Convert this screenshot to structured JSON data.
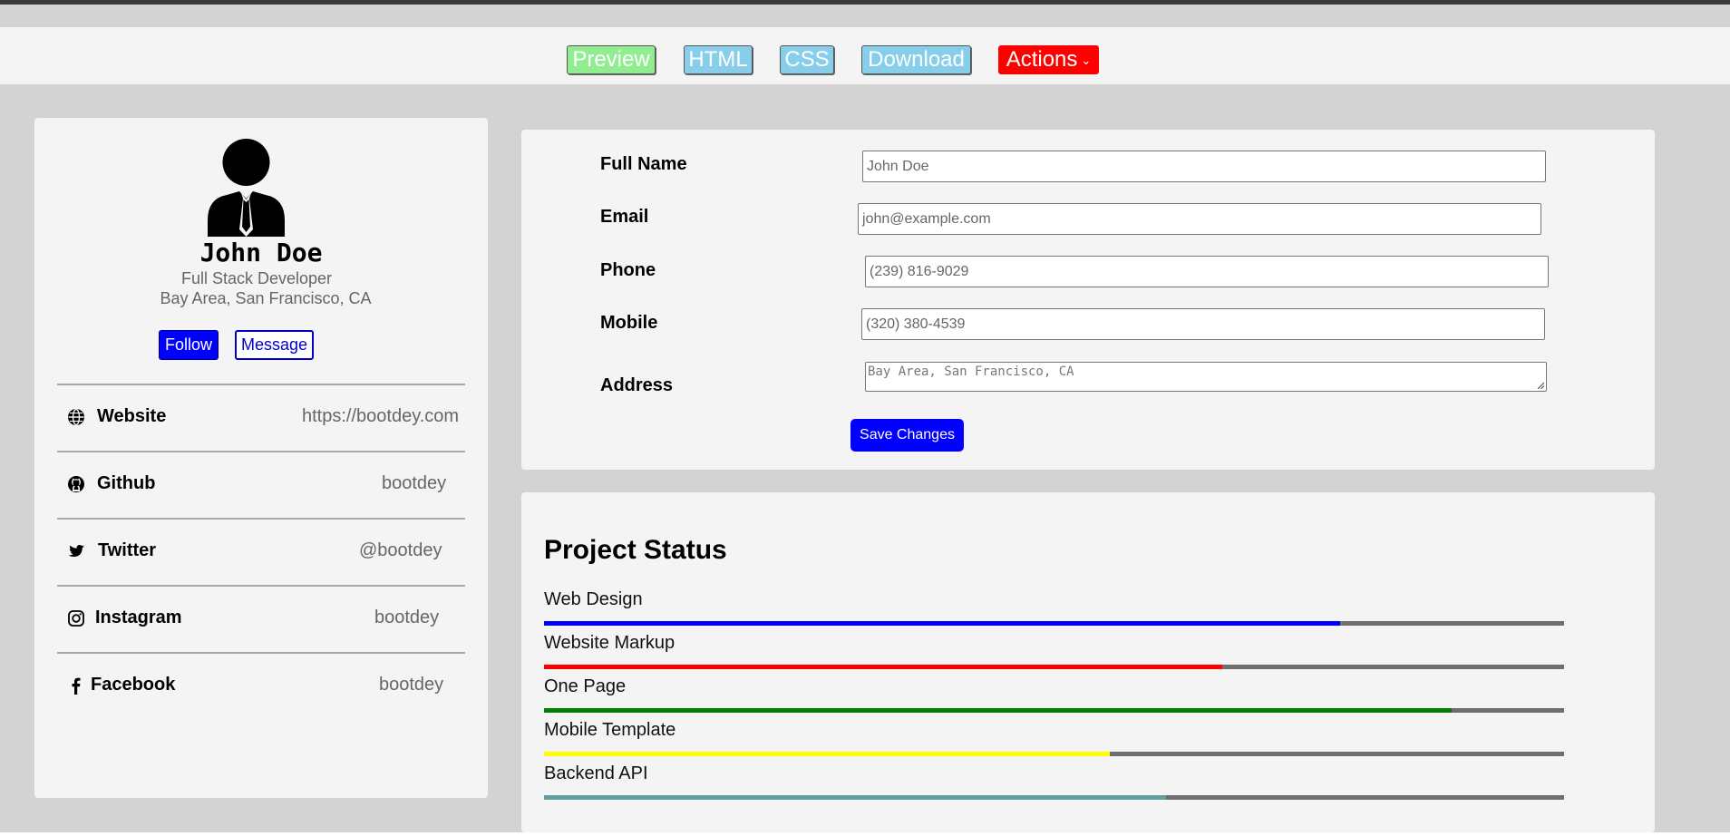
{
  "toolbar": {
    "preview": "Preview",
    "html": "HTML",
    "css": "CSS",
    "download": "Download",
    "actions": "Actions",
    "actions_chevron": "⌄"
  },
  "profile": {
    "name": "John Doe",
    "role": "Full Stack Developer",
    "location": "Bay Area, San Francisco, CA",
    "follow_label": "Follow",
    "message_label": "Message",
    "links": [
      {
        "label": "Website",
        "value": "https://bootdey.com",
        "icon": "globe-icon"
      },
      {
        "label": "Github",
        "value": "bootdey",
        "icon": "github-icon"
      },
      {
        "label": "Twitter",
        "value": "@bootdey",
        "icon": "twitter-icon"
      },
      {
        "label": "Instagram",
        "value": "bootdey",
        "icon": "instagram-icon"
      },
      {
        "label": "Facebook",
        "value": "bootdey",
        "icon": "facebook-icon"
      }
    ]
  },
  "form": {
    "full_name": {
      "label": "Full Name",
      "placeholder": "John Doe"
    },
    "email": {
      "label": "Email",
      "placeholder": "john@example.com"
    },
    "phone": {
      "label": "Phone",
      "placeholder": "(239) 816-9029"
    },
    "mobile": {
      "label": "Mobile",
      "placeholder": "(320) 380-4539"
    },
    "address": {
      "label": "Address",
      "placeholder": "Bay Area, San Francisco, CA"
    },
    "save_label": "Save Changes"
  },
  "project_status": {
    "title": "Project Status",
    "items": [
      {
        "label": "Web Design",
        "percent": 78,
        "color": "#0000ff"
      },
      {
        "label": "Website Markup",
        "percent": 66.5,
        "color": "#ff0000"
      },
      {
        "label": "One Page",
        "percent": 89,
        "color": "#008000"
      },
      {
        "label": "Mobile Template",
        "percent": 55.5,
        "color": "#ffff00"
      },
      {
        "label": "Backend API",
        "percent": 61,
        "color": "#5f9ea0"
      }
    ]
  },
  "colors": {
    "track": "#6e6e6e",
    "primary": "#0000ff",
    "danger": "#ff0000",
    "preview": "#90ee90",
    "secondary": "#87ceeb",
    "background": "#d3d3d3",
    "card": "#f4f4f4"
  }
}
